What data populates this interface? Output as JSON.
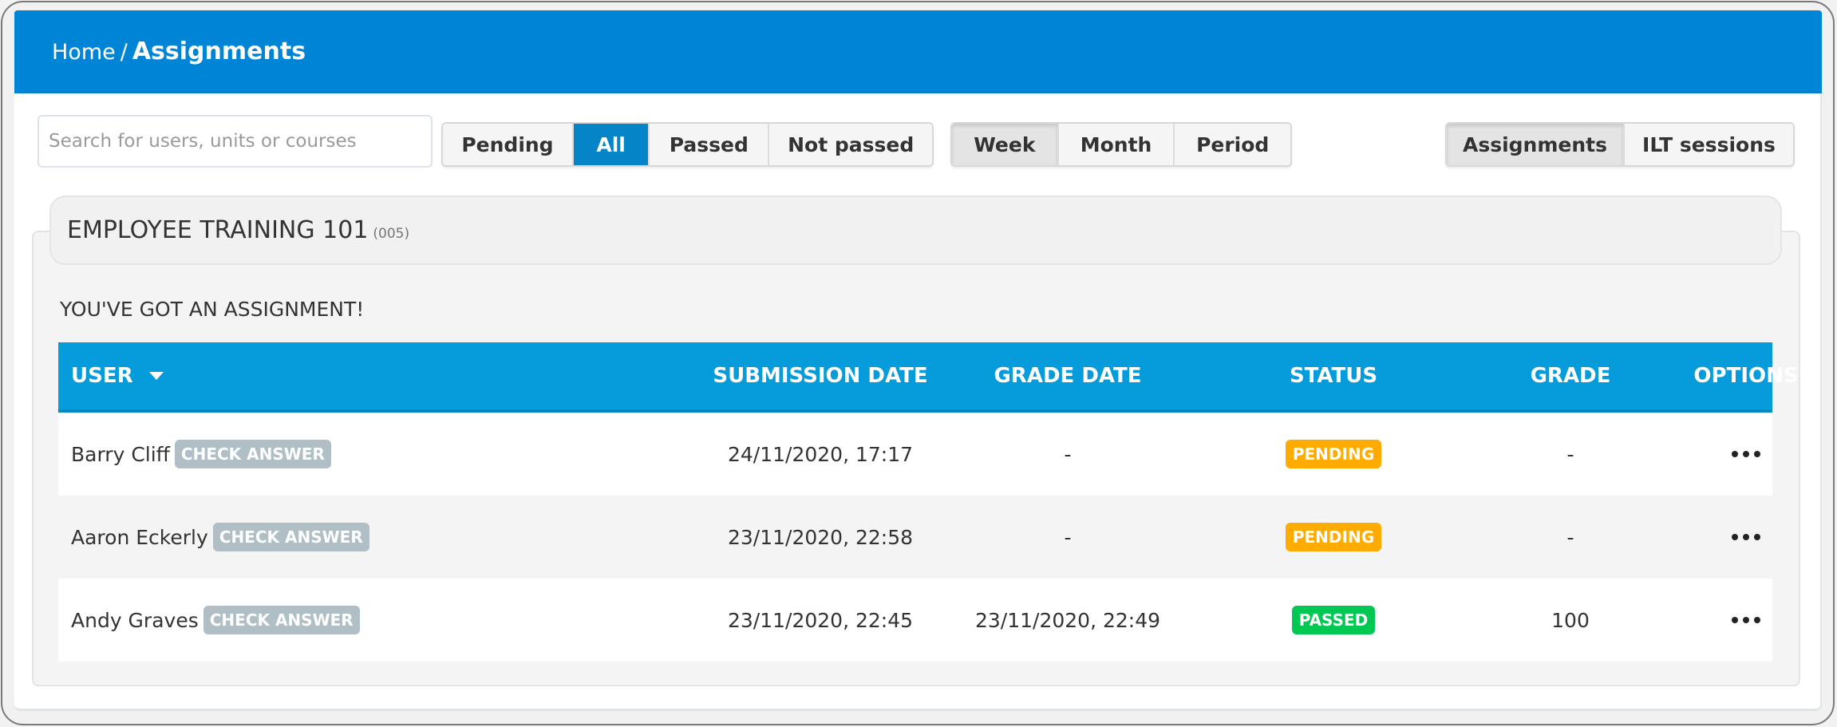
{
  "breadcrumb": {
    "home": "Home",
    "separator": "/",
    "current": "Assignments"
  },
  "search": {
    "placeholder": "Search for users, units or courses",
    "value": ""
  },
  "status_filters": [
    {
      "label": "Pending",
      "active": false
    },
    {
      "label": "All",
      "active": true
    },
    {
      "label": "Passed",
      "active": false
    },
    {
      "label": "Not passed",
      "active": false
    }
  ],
  "period_filters": [
    {
      "label": "Week",
      "active": true
    },
    {
      "label": "Month",
      "active": false
    },
    {
      "label": "Period",
      "active": false
    }
  ],
  "view_toggle": [
    {
      "label": "Assignments",
      "active": true
    },
    {
      "label": "ILT sessions",
      "active": false
    }
  ],
  "course": {
    "title": "EMPLOYEE TRAINING 101",
    "code": "(005)",
    "assignment_heading": "YOU'VE GOT AN ASSIGNMENT!"
  },
  "table": {
    "columns": {
      "user": "USER",
      "submission_date": "SUBMISSION DATE",
      "grade_date": "GRADE DATE",
      "status": "STATUS",
      "grade": "GRADE",
      "options": "OPTIONS"
    },
    "sort_icon": "caret-down-icon",
    "check_answer_label": "CHECK ANSWER",
    "rows": [
      {
        "user": "Barry Cliff",
        "submission_date": "24/11/2020, 17:17",
        "grade_date": "-",
        "status": "PENDING",
        "grade": "-"
      },
      {
        "user": "Aaron Eckerly",
        "submission_date": "23/11/2020, 22:58",
        "grade_date": "-",
        "status": "PENDING",
        "grade": "-"
      },
      {
        "user": "Andy Graves",
        "submission_date": "23/11/2020, 22:45",
        "grade_date": "23/11/2020, 22:49",
        "status": "PASSED",
        "grade": "100"
      }
    ]
  },
  "colors": {
    "header_blue": "#0085d6",
    "table_header": "#069cdb",
    "active_filter": "#0585c8",
    "pending": "#ffab00",
    "passed": "#00c853",
    "check_answer": "#b0bec5"
  }
}
